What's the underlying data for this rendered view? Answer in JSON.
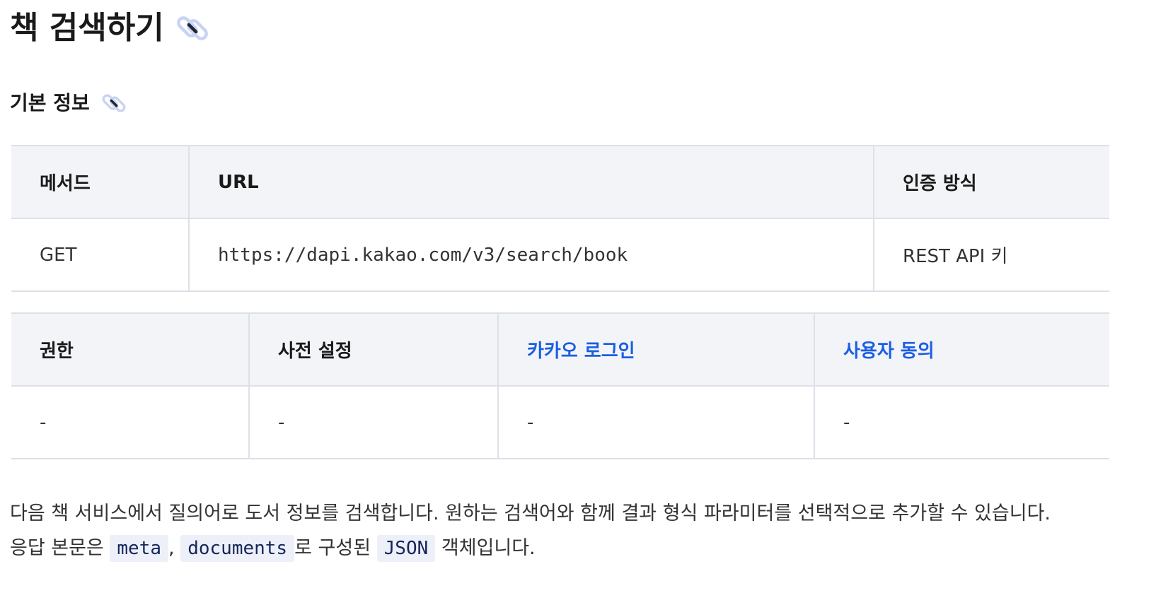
{
  "title": "책 검색하기",
  "basic_info": {
    "heading": "기본 정보",
    "table1": {
      "headers": [
        "메서드",
        "URL",
        "인증 방식"
      ],
      "row": [
        "GET",
        "https://dapi.kakao.com/v3/search/book",
        "REST API 키"
      ]
    },
    "table2": {
      "headers": [
        "권한",
        "사전 설정",
        "카카오 로그인",
        "사용자 동의"
      ],
      "row": [
        "-",
        "-",
        "-",
        "-"
      ]
    }
  },
  "description": {
    "line1": "다음 책 서비스에서 질의어로 도서 정보를 검색합니다. 원하는 검색어와 함께 결과 형식 파라미터를 선택적으로 추가할 수 있습니다.",
    "prefix": "응답 본문은",
    "code1": "meta",
    "sep": ",",
    "code2": "documents",
    "middle": "로 구성된",
    "code3": "JSON",
    "suffix": "객체입니다."
  },
  "colors": {
    "link": "#1a5fe3",
    "header_bg": "#f3f4f8",
    "border": "#dde0e7",
    "code_bg": "#edf0f8",
    "anchor_icon": "#c9d3f3"
  },
  "icons": {
    "anchor": "link-icon"
  }
}
